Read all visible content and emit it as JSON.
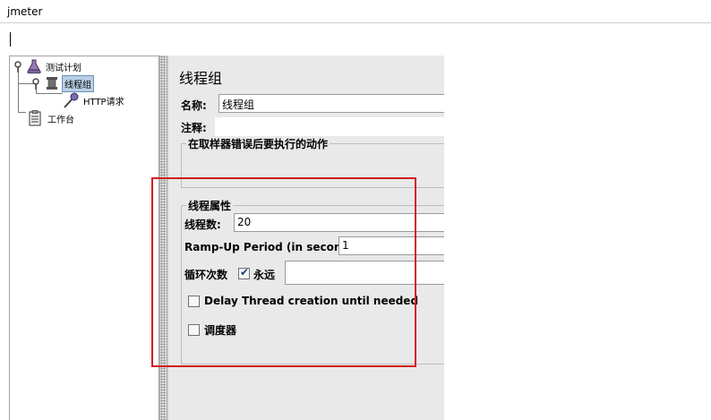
{
  "window": {
    "title": "jmeter"
  },
  "tree": {
    "items": [
      {
        "label": "测试计划"
      },
      {
        "label": "线程组"
      },
      {
        "label": "HTTP请求"
      },
      {
        "label": "工作台"
      }
    ]
  },
  "panel": {
    "title": "线程组",
    "name_label": "名称:",
    "name_value": "线程组",
    "comment_label": "注释:",
    "comment_value": "",
    "error_action_legend": "在取样器错误后要执行的动作",
    "thread_props_legend": "线程属性",
    "threads_label": "线程数:",
    "threads_value": "20",
    "rampup_label": "Ramp-Up Period (in seconds):",
    "rampup_value": "1",
    "loop_label": "循环次数",
    "forever_label": "永远",
    "forever_checked": true,
    "loop_value": "",
    "delay_label": "Delay Thread creation until needed",
    "delay_checked": false,
    "scheduler_label": "调度器",
    "scheduler_checked": false
  },
  "colors": {
    "highlight_box": "#d11e1e",
    "selection": "#b9cfe6"
  }
}
